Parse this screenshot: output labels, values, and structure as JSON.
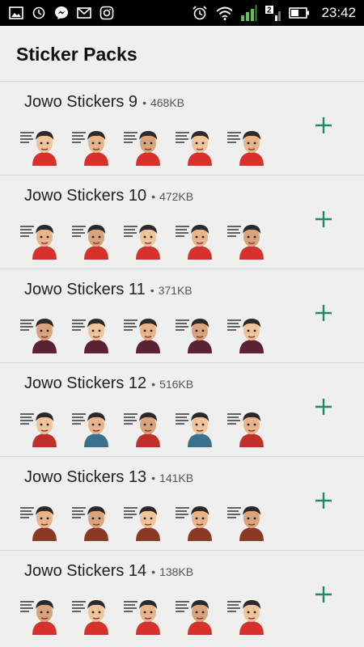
{
  "status_bar": {
    "time": "23:42",
    "left_icons": [
      "gallery-icon",
      "sync-icon",
      "messenger-icon",
      "mail-icon",
      "instagram-icon"
    ],
    "right_icons": [
      "alarm-icon",
      "wifi-icon",
      "signal-icon",
      "signal-2-icon",
      "battery-icon"
    ]
  },
  "header": {
    "title": "Sticker Packs"
  },
  "colors": {
    "accent": "#1e8a6e",
    "shirt": "#d6322b"
  },
  "packs": [
    {
      "name": "Jowo Stickers 9",
      "separator": "•",
      "size": "468KB"
    },
    {
      "name": "Jowo Stickers 10",
      "separator": "•",
      "size": "472KB"
    },
    {
      "name": "Jowo Stickers 11",
      "separator": "•",
      "size": "371KB"
    },
    {
      "name": "Jowo Stickers 12",
      "separator": "•",
      "size": "516KB"
    },
    {
      "name": "Jowo Stickers 13",
      "separator": "•",
      "size": "141KB"
    },
    {
      "name": "Jowo Stickers 14",
      "separator": "•",
      "size": "138KB"
    }
  ]
}
